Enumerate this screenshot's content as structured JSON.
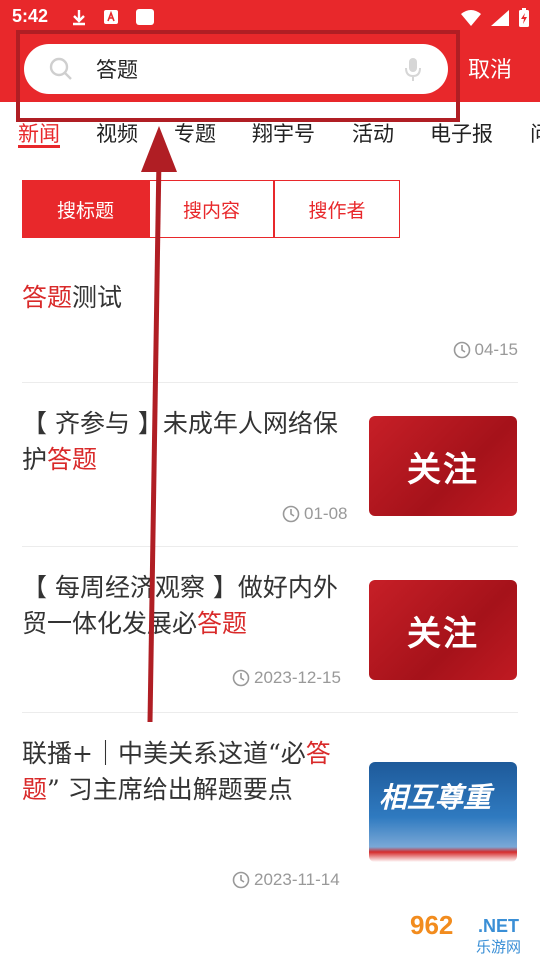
{
  "status_bar": {
    "time": "5:42"
  },
  "search": {
    "value": "答题",
    "cancel_label": "取消"
  },
  "tabs": [
    "新闻",
    "视频",
    "专题",
    "翔宇号",
    "活动",
    "电子报",
    "问"
  ],
  "segments": [
    "搜标题",
    "搜内容",
    "搜作者"
  ],
  "results": [
    {
      "title_before": "",
      "highlight": "答题",
      "title_after": "测试",
      "date": "04-15"
    },
    {
      "title_before": "【 齐参与 】未成年人网络保护",
      "highlight": "答题",
      "title_after": "",
      "date": "01-08",
      "thumb_text": "关注"
    },
    {
      "title_before": "【 每周经济观察 】做好内外贸一体化发展必",
      "highlight": "答题",
      "title_after": "",
      "date": "2023-12-15",
      "thumb_text": "关注"
    },
    {
      "title_before": "联播+｜中美关系这道“必",
      "highlight": "答题",
      "title_after": "” 习主席给出解题要点",
      "date": "2023-11-14",
      "thumb_text": "相互尊重"
    }
  ],
  "watermark": {
    "num": "962",
    "net": ".NET",
    "cn": "乐游网"
  },
  "colors": {
    "brand_red": "#e8282b",
    "highlight_box": "#b01e24",
    "date_gray": "#999999"
  }
}
